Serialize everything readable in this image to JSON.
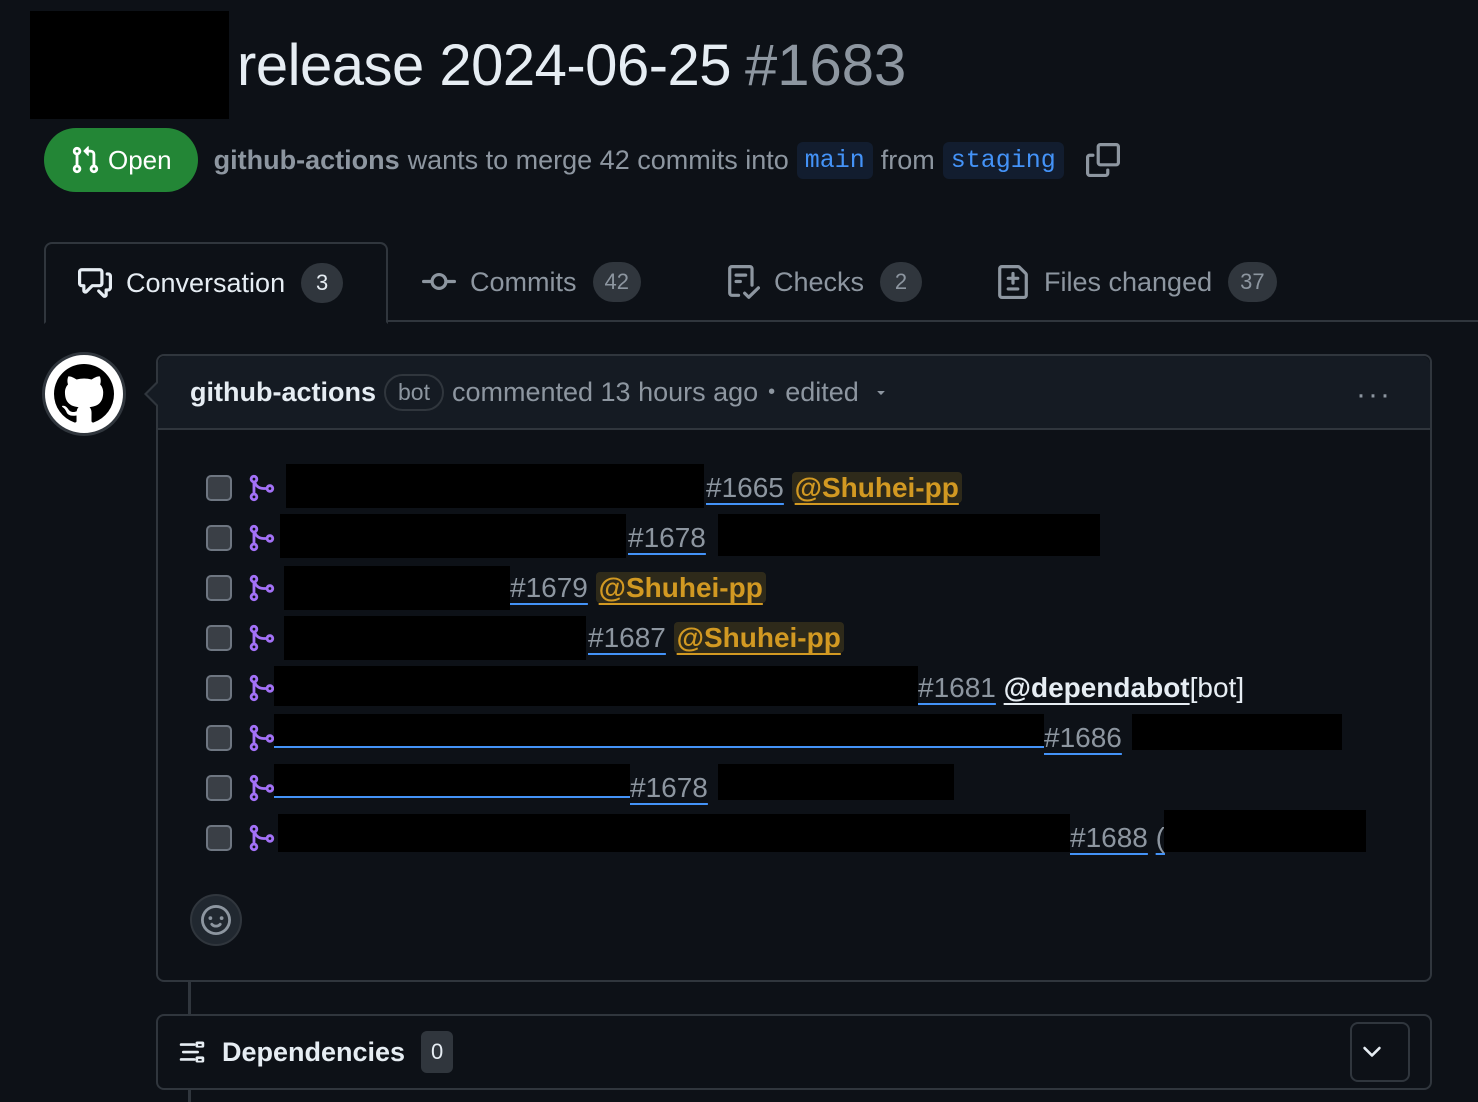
{
  "header": {
    "title": "release 2024-06-25",
    "number": "#1683",
    "state": "Open",
    "author": "github-actions",
    "merge_text": "wants to merge 42 commits into",
    "base_branch": "main",
    "from_text": "from",
    "head_branch": "staging"
  },
  "tabs": [
    {
      "label": "Conversation",
      "count": "3"
    },
    {
      "label": "Commits",
      "count": "42"
    },
    {
      "label": "Checks",
      "count": "2"
    },
    {
      "label": "Files changed",
      "count": "37"
    }
  ],
  "comment": {
    "author": "github-actions",
    "badge": "bot",
    "meta": "commented 13 hours ago",
    "separator": "•",
    "edited": "edited",
    "menu": "···"
  },
  "tasks": [
    {
      "pr": "#1665",
      "mention": "@Shuhei-pp",
      "suffix": ""
    },
    {
      "pr": "#1678",
      "mention": "",
      "suffix": ""
    },
    {
      "pr": "#1679",
      "mention": "@Shuhei-pp",
      "suffix": ""
    },
    {
      "pr": "#1687",
      "mention": "@Shuhei-pp",
      "suffix": ""
    },
    {
      "pr": "#1681",
      "mention": "@dependabot",
      "suffix": "[bot]"
    },
    {
      "pr": "#1686",
      "mention": "",
      "suffix": ""
    },
    {
      "pr": "#1678",
      "mention": "",
      "suffix": ""
    },
    {
      "pr": "#1688",
      "mention": "",
      "suffix": "("
    }
  ],
  "dependencies": {
    "title": "Dependencies",
    "count": "0"
  }
}
